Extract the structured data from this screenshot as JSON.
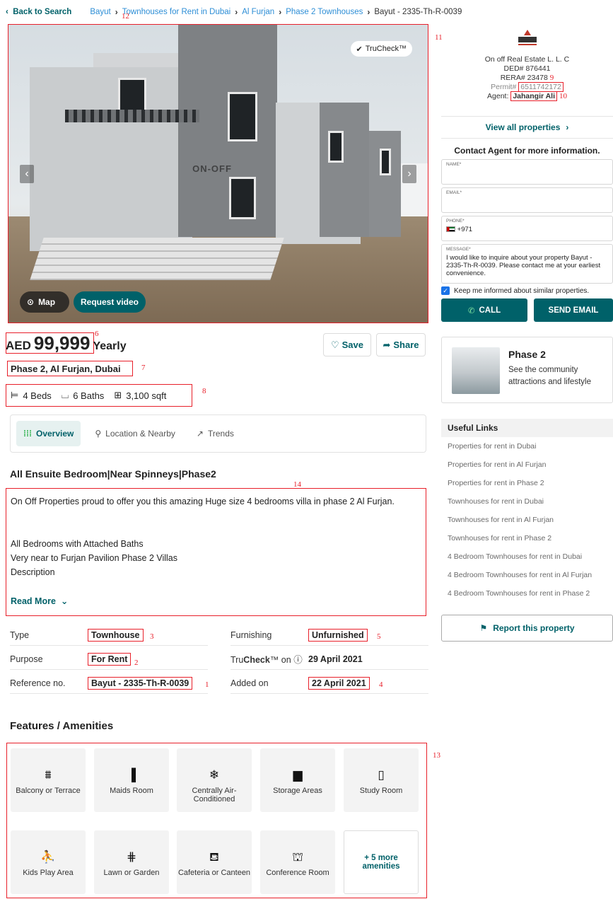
{
  "breadcrumb": {
    "back": "Back to Search",
    "items": [
      "Bayut",
      "Townhouses for Rent in Dubai",
      "Al Furjan",
      "Phase 2 Townhouses"
    ],
    "current": "Bayut - 2335-Th-R-0039"
  },
  "gallery": {
    "watermark": "ON-OFF",
    "trucheck_label": "TruCheck™",
    "map_label": "Map",
    "video_label": "Request video"
  },
  "listing": {
    "currency": "AED",
    "price": "99,999",
    "period": "Yearly",
    "save_label": "Save",
    "share_label": "Share",
    "location": "Phase 2, Al Furjan, Dubai",
    "beds": "4 Beds",
    "baths": "6 Baths",
    "area": "3,100 sqft"
  },
  "tabs": [
    {
      "label": "Overview",
      "icon": "grid-dots-icon"
    },
    {
      "label": "Location & Nearby",
      "icon": "map-pin-icon"
    },
    {
      "label": "Trends",
      "icon": "trend-up-icon"
    }
  ],
  "description": {
    "title": "All Ensuite Bedroom|Near Spinneys|Phase2",
    "lines": [
      "On Off Properties proud to offer you this amazing Huge size 4 bedrooms villa in phase 2 Al Furjan.",
      "",
      "",
      "All Bedrooms with Attached Baths",
      "Very near to Furjan Pavilion Phase 2 Villas",
      "Description"
    ],
    "read_more": "Read More"
  },
  "details": {
    "type": {
      "label": "Type",
      "value": "Townhouse"
    },
    "purpose": {
      "label": "Purpose",
      "value": "For Rent"
    },
    "reference": {
      "label": "Reference no.",
      "value": "Bayut - 2335-Th-R-0039"
    },
    "furnishing": {
      "label": "Furnishing",
      "value": "Unfurnished"
    },
    "trucheck": {
      "label_pre": "Tru",
      "label_bold": "Check",
      "label_post": "™ on",
      "value": "29 April 2021"
    },
    "added": {
      "label": "Added on",
      "value": "22 April 2021"
    }
  },
  "features": {
    "title": "Features / Amenities",
    "items": [
      {
        "label": "Balcony or Terrace",
        "icon": "balcony-icon",
        "glyph": "⩩"
      },
      {
        "label": "Maids Room",
        "icon": "door-icon",
        "glyph": "▐"
      },
      {
        "label": "Centrally Air-Conditioned",
        "icon": "snowflake-icon",
        "glyph": "❄"
      },
      {
        "label": "Storage Areas",
        "icon": "storage-box-icon",
        "glyph": "▆"
      },
      {
        "label": "Study Room",
        "icon": "book-icon",
        "glyph": "▯"
      },
      {
        "label": "Kids Play Area",
        "icon": "slide-icon",
        "glyph": "⛹"
      },
      {
        "label": "Lawn or Garden",
        "icon": "fence-icon",
        "glyph": "⋕"
      },
      {
        "label": "Cafeteria or Canteen",
        "icon": "cafeteria-icon",
        "glyph": "⛾"
      },
      {
        "label": "Conference Room",
        "icon": "conference-icon",
        "glyph": "⛫"
      }
    ],
    "more": "+ 5 more amenities"
  },
  "agency": {
    "logo_text": "ON-OFF",
    "name": "On off Real Estate L. L. C",
    "ded": "DED# 876441",
    "rera": "RERA# 23478",
    "permit_label": "Permit#",
    "permit": "6511742172",
    "agent_label": "Agent:",
    "agent": "Jahangir Ali",
    "view_all": "View all properties"
  },
  "contact": {
    "title": "Contact Agent for more information.",
    "name_label": "NAME*",
    "email_label": "EMAIL*",
    "phone_label": "PHONE*",
    "phone_code": "+971",
    "message_label": "MESSAGE*",
    "message": "I would like to inquire about your property Bayut - 2335-Th-R-0039. Please contact me at your earliest convenience.",
    "keep_informed": "Keep me informed about similar properties.",
    "call": "CALL",
    "send_email": "SEND EMAIL"
  },
  "community": {
    "name": "Phase 2",
    "subtitle": "See the community attractions and lifestyle"
  },
  "useful_links": {
    "title": "Useful Links",
    "items": [
      "Properties for rent in Dubai",
      "Properties for rent in Al Furjan",
      "Properties for rent in Phase 2",
      "Townhouses for rent in Dubai",
      "Townhouses for rent in Al Furjan",
      "Townhouses for rent in Phase 2",
      "4 Bedroom Townhouses for rent in Dubai",
      "4 Bedroom Townhouses for rent in Al Furjan",
      "4 Bedroom Townhouses for rent in Phase 2"
    ]
  },
  "report": "Report this property",
  "annotations": [
    "1",
    "2",
    "3",
    "4",
    "5",
    "6",
    "7",
    "8",
    "9",
    "10",
    "11",
    "12",
    "13",
    "14"
  ],
  "colors": {
    "accent": "#006169",
    "link": "#2d8ed6",
    "annotation": "#e8202a"
  }
}
